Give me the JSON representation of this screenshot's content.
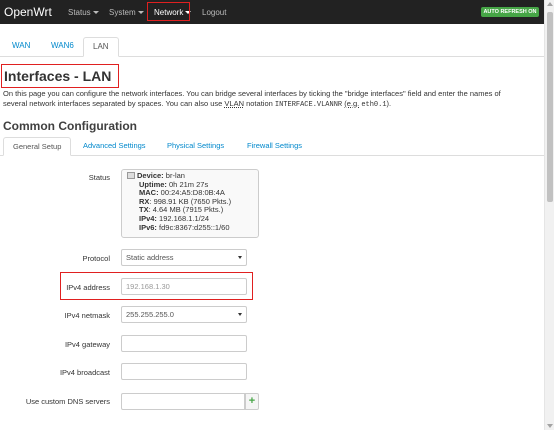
{
  "navbar": {
    "brand": "OpenWrt",
    "menu": [
      {
        "label": "Status",
        "dropdown": true
      },
      {
        "label": "System",
        "dropdown": true
      },
      {
        "label": "Network",
        "dropdown": true
      },
      {
        "label": "Logout",
        "dropdown": false
      }
    ],
    "auto_refresh": "AUTO REFRESH ON"
  },
  "tabs": [
    "WAN",
    "WAN6",
    "LAN"
  ],
  "active_tab": "LAN",
  "page": {
    "title": "Interfaces - LAN",
    "desc_1": "On this page you can configure the network interfaces. You can bridge several interfaces by ticking the \"bridge interfaces\" field and enter the names of",
    "desc_2a": "several network interfaces separated by spaces. You can also use",
    "desc_vlan": "VLAN",
    "desc_2b": "notation",
    "desc_code1": "INTERFACE.VLANNR",
    "desc_eg": "(e.g.",
    "desc_code2": "eth0.1",
    "desc_end": ")."
  },
  "section_title": "Common Configuration",
  "subtabs": [
    "General Setup",
    "Advanced Settings",
    "Physical Settings",
    "Firewall Settings"
  ],
  "form": {
    "status_label": "Status",
    "status": {
      "device_label": "Device:",
      "device": "br-lan",
      "uptime_label": "Uptime:",
      "uptime": "0h 21m 27s",
      "mac_label": "MAC:",
      "mac": "00:24:A5:D8:0B:4A",
      "rx_label": "RX",
      "rx": ": 998.91 KB (7650 Pkts.)",
      "tx_label": "TX",
      "tx": ": 4.64 MB (7915 Pkts.)",
      "ipv4_label": "IPv4:",
      "ipv4": "192.168.1.1/24",
      "ipv6_label": "IPv6:",
      "ipv6": "fd9c:8367:d255::1/60"
    },
    "protocol_label": "Protocol",
    "protocol_value": "Static address",
    "ipv4_address_label": "IPv4 address",
    "ipv4_address_placeholder": "192.168.1.30",
    "ipv4_netmask_label": "IPv4 netmask",
    "ipv4_netmask_value": "255.255.255.0",
    "ipv4_gateway_label": "IPv4 gateway",
    "ipv4_broadcast_label": "IPv4 broadcast",
    "dns_label": "Use custom DNS servers",
    "add_button": "+"
  },
  "colors": {
    "navbar_bg": "#222222",
    "link": "#0088cc",
    "highlight": "#e02020",
    "auto_refresh_bg": "#46a546"
  }
}
